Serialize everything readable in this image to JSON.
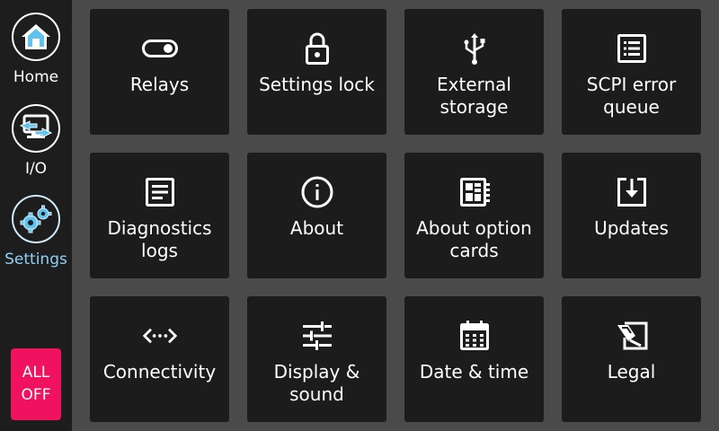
{
  "sidebar": {
    "items": [
      {
        "label": "Home",
        "icon": "home-icon"
      },
      {
        "label": "I/O",
        "icon": "io-icon"
      },
      {
        "label": "Settings",
        "icon": "settings-icon",
        "active": true
      }
    ],
    "all_off": {
      "line1": "ALL",
      "line2": "OFF"
    }
  },
  "tiles": [
    {
      "label": "Relays",
      "icon": "toggle-icon"
    },
    {
      "label": "Settings lock",
      "icon": "lock-icon"
    },
    {
      "label": "External\nstorage",
      "icon": "usb-icon"
    },
    {
      "label": "SCPI error\nqueue",
      "icon": "list-icon"
    },
    {
      "label": "Diagnostics\nlogs",
      "icon": "document-icon"
    },
    {
      "label": "About",
      "icon": "info-icon"
    },
    {
      "label": "About option\ncards",
      "icon": "card-icon"
    },
    {
      "label": "Updates",
      "icon": "download-icon"
    },
    {
      "label": "Connectivity",
      "icon": "connectivity-icon"
    },
    {
      "label": "Display &\nsound",
      "icon": "sliders-icon"
    },
    {
      "label": "Date & time",
      "icon": "calendar-icon"
    },
    {
      "label": "Legal",
      "icon": "legal-icon"
    }
  ],
  "colors": {
    "background": "#4a4a4a",
    "sidebar": "#1d1d1d",
    "tile": "#1c1c1c",
    "active_accent": "#8fd0f3",
    "home_icon": "#5fc3ee",
    "all_off": "#f0125e"
  }
}
